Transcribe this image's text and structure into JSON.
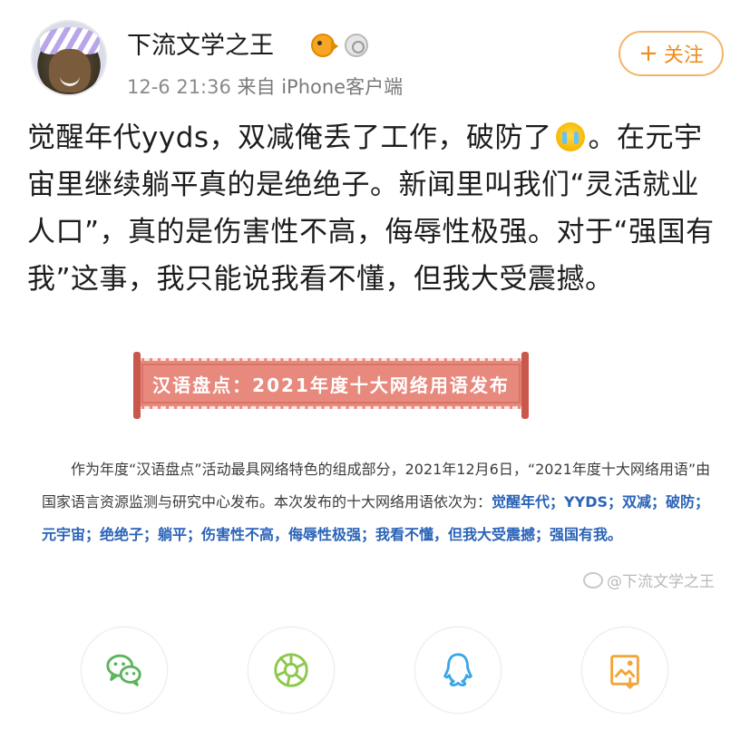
{
  "author": {
    "name": "下流文学之王",
    "badges": [
      "fish-badge-icon",
      "medal-badge-icon"
    ]
  },
  "meta": {
    "time": "12-6 21:36",
    "source": "来自 iPhone客户端"
  },
  "follow_button": {
    "plus": "+",
    "label": "关注"
  },
  "post": {
    "text_part1": "觉醒年代yyds，双减俺丢了工作，破防了",
    "emoji": "crying-face-icon",
    "text_part2": "。在元宇宙里继续躺平真的是绝绝子。新闻里叫我们“灵活就业人口”，真的是伤害性不高，侮辱性极强。对于“强国有我”这事，我只能说我看不懂，但我大受震撼。"
  },
  "embed": {
    "banner_title": "汉语盘点：2021年度十大网络用语发布",
    "paragraph_prefix": "作为年度“汉语盘点”活动最具网络特色的组成部分，2021年12月6日，“2021年度十大网络用语”由国家语言资源监测与研究中心发布。本次发布的十大网络用语依次为：",
    "paragraph_terms": "觉醒年代；YYDS；双减；破防；元宇宙；绝绝子；躺平；伤害性不高，侮辱性极强；我看不懂，但我大受震撼；强国有我。",
    "watermark": "@下流文学之王"
  },
  "share_bar": {
    "items": [
      "wechat-icon",
      "moments-icon",
      "qq-icon",
      "save-image-icon"
    ]
  },
  "colors": {
    "accent_orange": "#f08c1c",
    "banner_red": "#e8897e",
    "term_blue": "#2a63b8",
    "wechat_green": "#5bb45c",
    "qq_blue": "#3aa6e8"
  }
}
